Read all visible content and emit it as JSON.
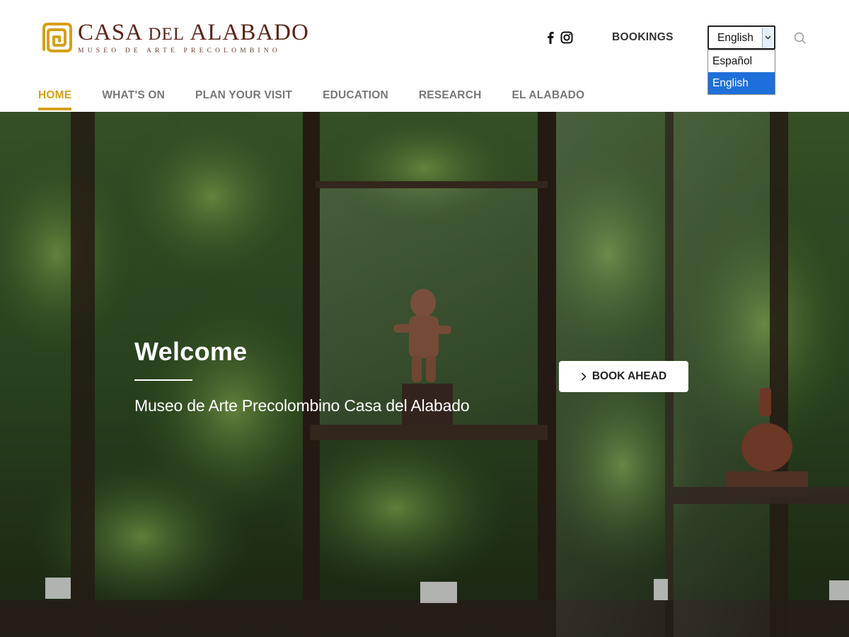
{
  "brand": {
    "title_main": "CASA ",
    "title_small": "DEL",
    "title_end": " ALABADO",
    "subtitle": "MUSEO DE ARTE PRECOLOMBINO",
    "accent_color": "#d4a017",
    "text_color": "#5a2418"
  },
  "header": {
    "social": [
      {
        "icon": "facebook-icon"
      },
      {
        "icon": "instagram-icon"
      }
    ],
    "bookings_label": "BOOKINGS",
    "language": {
      "selected": "English",
      "options": [
        "Español",
        "English"
      ]
    },
    "search_icon": "search-icon"
  },
  "nav": {
    "items": [
      {
        "label": "HOME",
        "active": true
      },
      {
        "label": "WHAT'S ON",
        "active": false
      },
      {
        "label": "PLAN YOUR VISIT",
        "active": false
      },
      {
        "label": "EDUCATION",
        "active": false
      },
      {
        "label": "RESEARCH",
        "active": false
      },
      {
        "label": "EL ALABADO",
        "active": false
      }
    ]
  },
  "hero": {
    "title": "Welcome",
    "subtitle": "Museo de Arte Precolombino Casa del Alabado",
    "cta_label": "BOOK AHEAD"
  }
}
